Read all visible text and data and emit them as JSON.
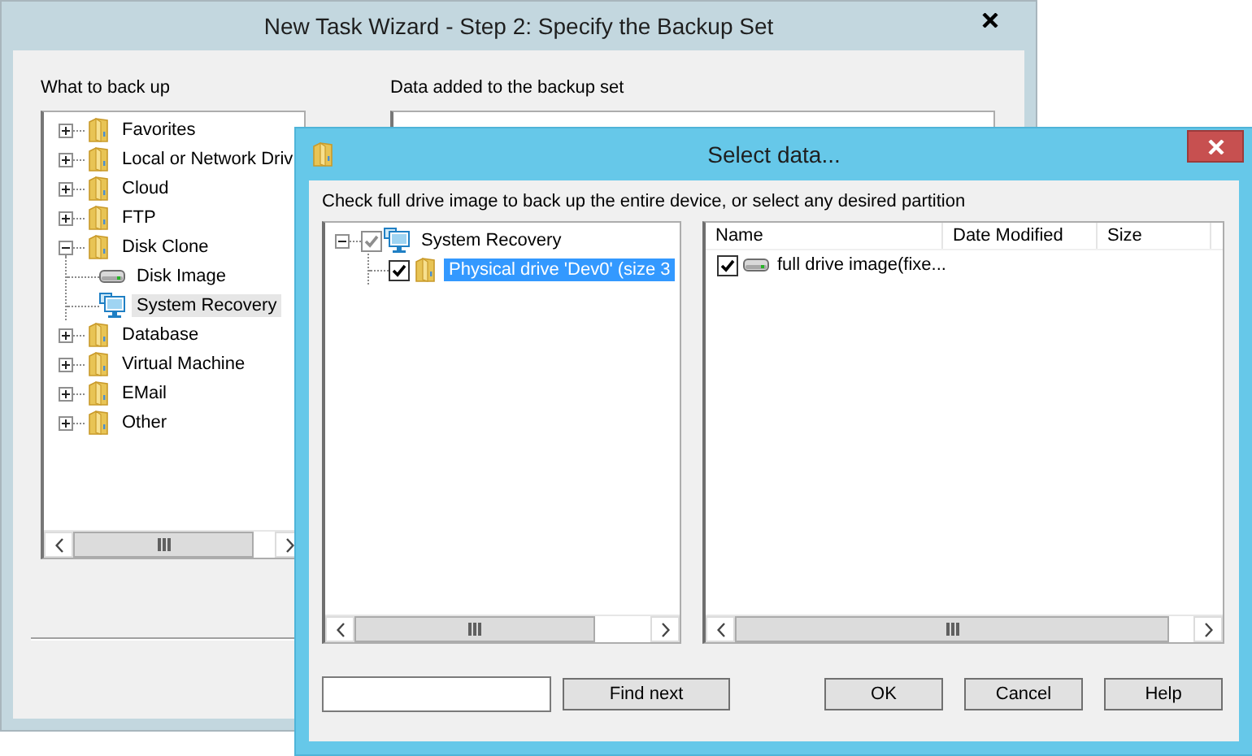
{
  "wizard": {
    "title": "New Task Wizard - Step 2: Specify the Backup Set",
    "source_label": "What to back up",
    "source_tree": [
      {
        "label": "Favorites",
        "kind": "folder",
        "expanded": false,
        "selected": false
      },
      {
        "label": "Local or Network Driv",
        "kind": "folder",
        "expanded": false,
        "selected": false
      },
      {
        "label": "Cloud",
        "kind": "folder",
        "expanded": false,
        "selected": false
      },
      {
        "label": "FTP",
        "kind": "folder",
        "expanded": false,
        "selected": false
      },
      {
        "label": "Disk Clone",
        "kind": "folder",
        "expanded": true,
        "selected": false,
        "children": [
          {
            "label": "Disk Image",
            "kind": "drive",
            "selected": false
          },
          {
            "label": "System Recovery",
            "kind": "computer",
            "selected": true
          }
        ]
      },
      {
        "label": "Database",
        "kind": "folder",
        "expanded": false,
        "selected": false
      },
      {
        "label": "Virtual Machine",
        "kind": "folder",
        "expanded": false,
        "selected": false
      },
      {
        "label": "EMail",
        "kind": "folder",
        "expanded": false,
        "selected": false
      },
      {
        "label": "Other",
        "kind": "folder",
        "expanded": false,
        "selected": false
      }
    ],
    "target_label": "Data added to the backup set"
  },
  "dialog": {
    "title": "Select data...",
    "instruction": "Check full drive image to back up the entire device, or select any desired partition",
    "tree": [
      {
        "label": "System Recovery",
        "kind": "computer",
        "expanded": true,
        "checked": true,
        "disabled": true,
        "selected": false,
        "children": [
          {
            "label": "Physical drive 'Dev0' (size 3",
            "kind": "folder",
            "checked": true,
            "disabled": false,
            "selected": true
          }
        ]
      }
    ],
    "columns": [
      "Name",
      "Date Modified",
      "Size"
    ],
    "rows": [
      {
        "name": "full drive image(fixe...",
        "kind": "drive",
        "checked": true
      }
    ],
    "find_button": "Find next",
    "buttons": [
      "OK",
      "Cancel",
      "Help"
    ]
  }
}
